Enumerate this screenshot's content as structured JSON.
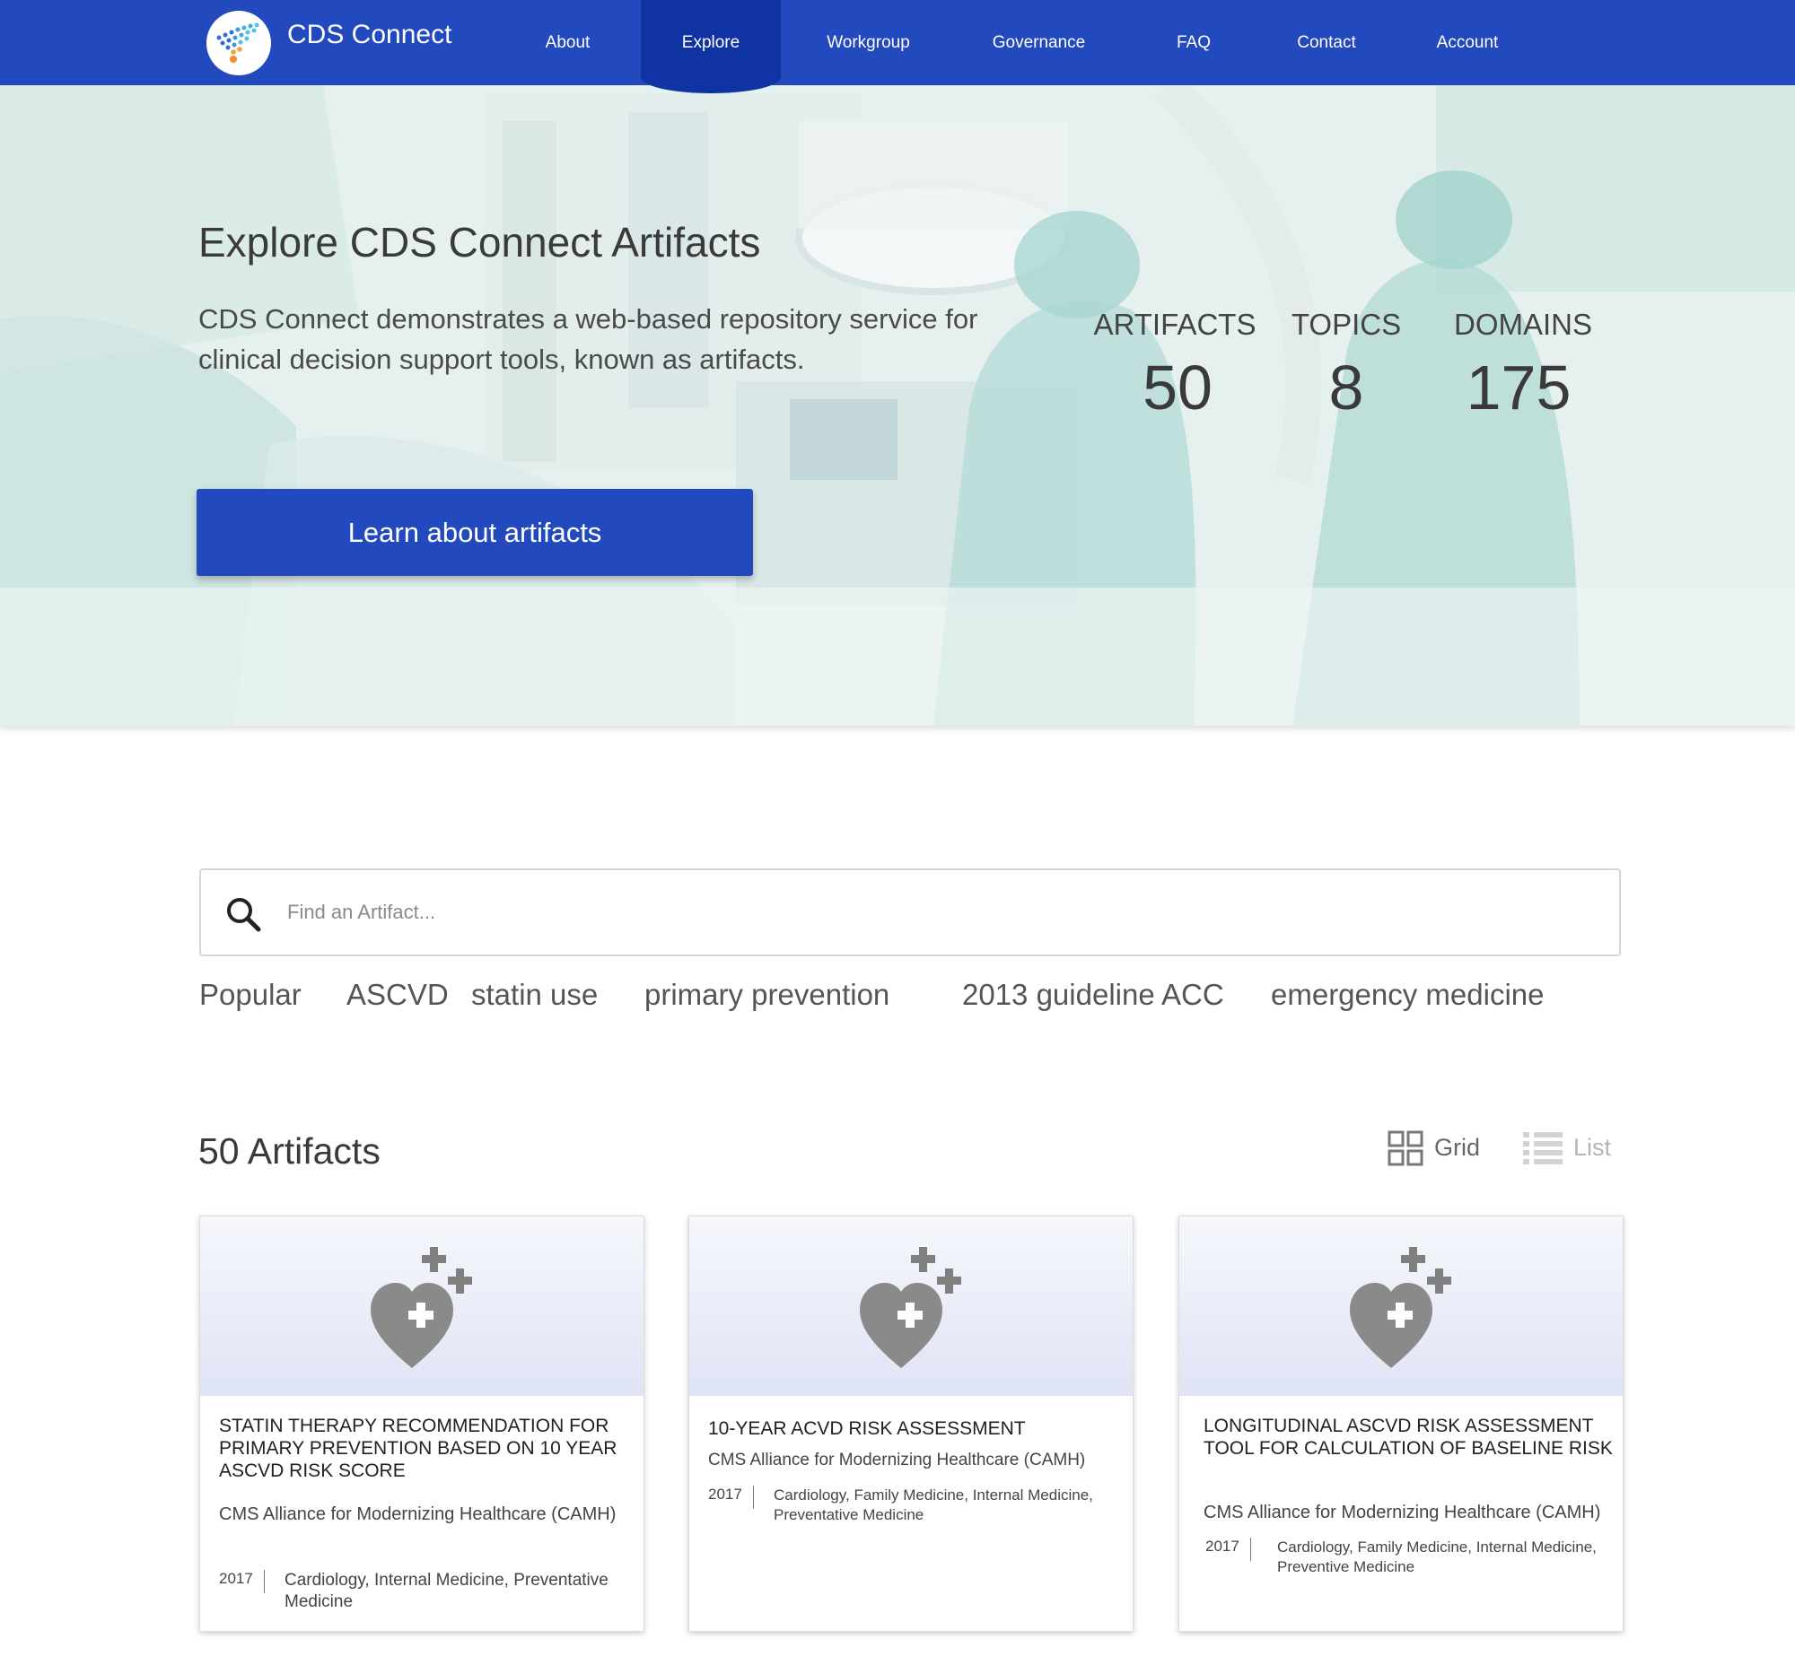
{
  "nav": {
    "brand": "CDS Connect",
    "items": [
      {
        "label": "About"
      },
      {
        "label": "Explore"
      },
      {
        "label": "Workgroup"
      },
      {
        "label": "Governance"
      },
      {
        "label": "FAQ"
      },
      {
        "label": "Contact"
      },
      {
        "label": "Account"
      }
    ],
    "active": "Explore",
    "color": "#2249bd",
    "active_color": "#0f33a3"
  },
  "hero": {
    "title": "Explore CDS Connect Artifacts",
    "description": "CDS Connect demonstrates a web-based repository service for clinical decision support tools, known as artifacts.",
    "cta_label": "Learn about artifacts",
    "stats": [
      {
        "label": "ARTIFACTS",
        "value": "50"
      },
      {
        "label": "TOPICS",
        "value": "8"
      },
      {
        "label": "DOMAINS",
        "value": "175"
      }
    ]
  },
  "search": {
    "placeholder": "Find an Artifact...",
    "value": "",
    "icon": "search-icon"
  },
  "popular": {
    "label": "Popular",
    "tags": [
      "ASCVD",
      "statin use",
      "primary prevention",
      "2013 guideline ACC",
      "emergency medicine"
    ]
  },
  "results": {
    "count_label": "50 Artifacts",
    "views": [
      {
        "label": "Grid",
        "icon": "grid-icon",
        "selected": true
      },
      {
        "label": "List",
        "icon": "list-icon",
        "selected": false
      }
    ]
  },
  "artifacts": [
    {
      "title": "STATIN THERAPY RECOMMENDATION FOR PRIMARY PREVENTION BASED ON 10 YEAR ASCVD RISK SCORE",
      "org": "CMS Alliance for Modernizing Healthcare (CAMH)",
      "year": "2017",
      "tags": "Cardiology, Internal Medicine, Preventative Medicine",
      "icon": "heart-plus-icon"
    },
    {
      "title": "10-YEAR ACVD RISK ASSESSMENT",
      "org": "CMS Alliance for Modernizing Healthcare (CAMH)",
      "year": "2017",
      "tags": "Cardiology, Family Medicine, Internal Medicine, Preventative Medicine",
      "icon": "heart-plus-icon"
    },
    {
      "title": "LONGITUDINAL ASCVD RISK ASSESSMENT TOOL  FOR CALCULATION OF BASELINE RISK",
      "org": "CMS Alliance for Modernizing Healthcare (CAMH)",
      "year": "2017",
      "tags": "Cardiology, Family Medicine, Internal Medicine, Preventive Medicine",
      "icon": "heart-plus-icon"
    }
  ]
}
